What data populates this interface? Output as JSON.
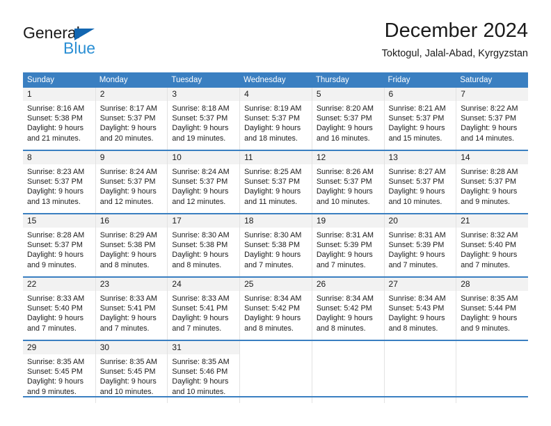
{
  "brand": {
    "name_part1": "General",
    "name_part2": "Blue",
    "primary_color": "#1266b1",
    "accent_color": "#2b8fd4"
  },
  "header": {
    "title": "December 2024",
    "subtitle": "Toktogul, Jalal-Abad, Kyrgyzstan"
  },
  "calendar": {
    "header_bg": "#3a7fc1",
    "daynum_bg": "#f2f2f2",
    "weekday_headers": [
      "Sunday",
      "Monday",
      "Tuesday",
      "Wednesday",
      "Thursday",
      "Friday",
      "Saturday"
    ],
    "weeks": [
      [
        {
          "day": "1",
          "sunrise": "Sunrise: 8:16 AM",
          "sunset": "Sunset: 5:38 PM",
          "daylight_line1": "Daylight: 9 hours",
          "daylight_line2": "and 21 minutes."
        },
        {
          "day": "2",
          "sunrise": "Sunrise: 8:17 AM",
          "sunset": "Sunset: 5:37 PM",
          "daylight_line1": "Daylight: 9 hours",
          "daylight_line2": "and 20 minutes."
        },
        {
          "day": "3",
          "sunrise": "Sunrise: 8:18 AM",
          "sunset": "Sunset: 5:37 PM",
          "daylight_line1": "Daylight: 9 hours",
          "daylight_line2": "and 19 minutes."
        },
        {
          "day": "4",
          "sunrise": "Sunrise: 8:19 AM",
          "sunset": "Sunset: 5:37 PM",
          "daylight_line1": "Daylight: 9 hours",
          "daylight_line2": "and 18 minutes."
        },
        {
          "day": "5",
          "sunrise": "Sunrise: 8:20 AM",
          "sunset": "Sunset: 5:37 PM",
          "daylight_line1": "Daylight: 9 hours",
          "daylight_line2": "and 16 minutes."
        },
        {
          "day": "6",
          "sunrise": "Sunrise: 8:21 AM",
          "sunset": "Sunset: 5:37 PM",
          "daylight_line1": "Daylight: 9 hours",
          "daylight_line2": "and 15 minutes."
        },
        {
          "day": "7",
          "sunrise": "Sunrise: 8:22 AM",
          "sunset": "Sunset: 5:37 PM",
          "daylight_line1": "Daylight: 9 hours",
          "daylight_line2": "and 14 minutes."
        }
      ],
      [
        {
          "day": "8",
          "sunrise": "Sunrise: 8:23 AM",
          "sunset": "Sunset: 5:37 PM",
          "daylight_line1": "Daylight: 9 hours",
          "daylight_line2": "and 13 minutes."
        },
        {
          "day": "9",
          "sunrise": "Sunrise: 8:24 AM",
          "sunset": "Sunset: 5:37 PM",
          "daylight_line1": "Daylight: 9 hours",
          "daylight_line2": "and 12 minutes."
        },
        {
          "day": "10",
          "sunrise": "Sunrise: 8:24 AM",
          "sunset": "Sunset: 5:37 PM",
          "daylight_line1": "Daylight: 9 hours",
          "daylight_line2": "and 12 minutes."
        },
        {
          "day": "11",
          "sunrise": "Sunrise: 8:25 AM",
          "sunset": "Sunset: 5:37 PM",
          "daylight_line1": "Daylight: 9 hours",
          "daylight_line2": "and 11 minutes."
        },
        {
          "day": "12",
          "sunrise": "Sunrise: 8:26 AM",
          "sunset": "Sunset: 5:37 PM",
          "daylight_line1": "Daylight: 9 hours",
          "daylight_line2": "and 10 minutes."
        },
        {
          "day": "13",
          "sunrise": "Sunrise: 8:27 AM",
          "sunset": "Sunset: 5:37 PM",
          "daylight_line1": "Daylight: 9 hours",
          "daylight_line2": "and 10 minutes."
        },
        {
          "day": "14",
          "sunrise": "Sunrise: 8:28 AM",
          "sunset": "Sunset: 5:37 PM",
          "daylight_line1": "Daylight: 9 hours",
          "daylight_line2": "and 9 minutes."
        }
      ],
      [
        {
          "day": "15",
          "sunrise": "Sunrise: 8:28 AM",
          "sunset": "Sunset: 5:37 PM",
          "daylight_line1": "Daylight: 9 hours",
          "daylight_line2": "and 9 minutes."
        },
        {
          "day": "16",
          "sunrise": "Sunrise: 8:29 AM",
          "sunset": "Sunset: 5:38 PM",
          "daylight_line1": "Daylight: 9 hours",
          "daylight_line2": "and 8 minutes."
        },
        {
          "day": "17",
          "sunrise": "Sunrise: 8:30 AM",
          "sunset": "Sunset: 5:38 PM",
          "daylight_line1": "Daylight: 9 hours",
          "daylight_line2": "and 8 minutes."
        },
        {
          "day": "18",
          "sunrise": "Sunrise: 8:30 AM",
          "sunset": "Sunset: 5:38 PM",
          "daylight_line1": "Daylight: 9 hours",
          "daylight_line2": "and 7 minutes."
        },
        {
          "day": "19",
          "sunrise": "Sunrise: 8:31 AM",
          "sunset": "Sunset: 5:39 PM",
          "daylight_line1": "Daylight: 9 hours",
          "daylight_line2": "and 7 minutes."
        },
        {
          "day": "20",
          "sunrise": "Sunrise: 8:31 AM",
          "sunset": "Sunset: 5:39 PM",
          "daylight_line1": "Daylight: 9 hours",
          "daylight_line2": "and 7 minutes."
        },
        {
          "day": "21",
          "sunrise": "Sunrise: 8:32 AM",
          "sunset": "Sunset: 5:40 PM",
          "daylight_line1": "Daylight: 9 hours",
          "daylight_line2": "and 7 minutes."
        }
      ],
      [
        {
          "day": "22",
          "sunrise": "Sunrise: 8:33 AM",
          "sunset": "Sunset: 5:40 PM",
          "daylight_line1": "Daylight: 9 hours",
          "daylight_line2": "and 7 minutes."
        },
        {
          "day": "23",
          "sunrise": "Sunrise: 8:33 AM",
          "sunset": "Sunset: 5:41 PM",
          "daylight_line1": "Daylight: 9 hours",
          "daylight_line2": "and 7 minutes."
        },
        {
          "day": "24",
          "sunrise": "Sunrise: 8:33 AM",
          "sunset": "Sunset: 5:41 PM",
          "daylight_line1": "Daylight: 9 hours",
          "daylight_line2": "and 7 minutes."
        },
        {
          "day": "25",
          "sunrise": "Sunrise: 8:34 AM",
          "sunset": "Sunset: 5:42 PM",
          "daylight_line1": "Daylight: 9 hours",
          "daylight_line2": "and 8 minutes."
        },
        {
          "day": "26",
          "sunrise": "Sunrise: 8:34 AM",
          "sunset": "Sunset: 5:42 PM",
          "daylight_line1": "Daylight: 9 hours",
          "daylight_line2": "and 8 minutes."
        },
        {
          "day": "27",
          "sunrise": "Sunrise: 8:34 AM",
          "sunset": "Sunset: 5:43 PM",
          "daylight_line1": "Daylight: 9 hours",
          "daylight_line2": "and 8 minutes."
        },
        {
          "day": "28",
          "sunrise": "Sunrise: 8:35 AM",
          "sunset": "Sunset: 5:44 PM",
          "daylight_line1": "Daylight: 9 hours",
          "daylight_line2": "and 9 minutes."
        }
      ],
      [
        {
          "day": "29",
          "sunrise": "Sunrise: 8:35 AM",
          "sunset": "Sunset: 5:45 PM",
          "daylight_line1": "Daylight: 9 hours",
          "daylight_line2": "and 9 minutes."
        },
        {
          "day": "30",
          "sunrise": "Sunrise: 8:35 AM",
          "sunset": "Sunset: 5:45 PM",
          "daylight_line1": "Daylight: 9 hours",
          "daylight_line2": "and 10 minutes."
        },
        {
          "day": "31",
          "sunrise": "Sunrise: 8:35 AM",
          "sunset": "Sunset: 5:46 PM",
          "daylight_line1": "Daylight: 9 hours",
          "daylight_line2": "and 10 minutes."
        },
        {
          "day": "",
          "sunrise": "",
          "sunset": "",
          "daylight_line1": "",
          "daylight_line2": ""
        },
        {
          "day": "",
          "sunrise": "",
          "sunset": "",
          "daylight_line1": "",
          "daylight_line2": ""
        },
        {
          "day": "",
          "sunrise": "",
          "sunset": "",
          "daylight_line1": "",
          "daylight_line2": ""
        },
        {
          "day": "",
          "sunrise": "",
          "sunset": "",
          "daylight_line1": "",
          "daylight_line2": ""
        }
      ]
    ]
  }
}
